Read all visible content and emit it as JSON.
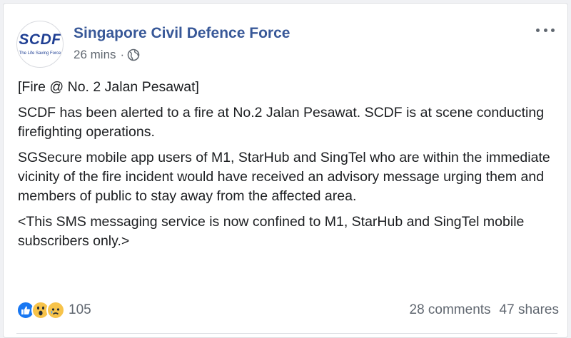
{
  "post": {
    "author": {
      "name": "Singapore Civil Defence Force",
      "avatar_logo": "SCDF",
      "avatar_tagline": "The Life Saving Force"
    },
    "time": "26 mins",
    "separator": "·",
    "privacy_icon": "globe-icon",
    "paragraphs": [
      "[Fire @ No. 2 Jalan Pesawat]",
      "SCDF has been alerted to a fire at No.2 Jalan Pesawat. SCDF is at scene conducting firefighting operations.",
      "SGSecure mobile app users of M1, StarHub and SingTel who are within the immediate vicinity of the fire incident would have received an advisory message urging them and members of public to stay away from the affected area.",
      "<This SMS messaging service is now confined to M1, StarHub and SingTel mobile subscribers only.>"
    ]
  },
  "engagement": {
    "reaction_icons": [
      "like-icon",
      "wow-icon",
      "sad-icon"
    ],
    "reaction_count": "105",
    "comments": "28 comments",
    "shares": "47 shares"
  },
  "colors": {
    "link": "#385898",
    "secondary_text": "#606770",
    "like_blue": "#1877f2",
    "emoji_yellow": "#f7c34a"
  }
}
